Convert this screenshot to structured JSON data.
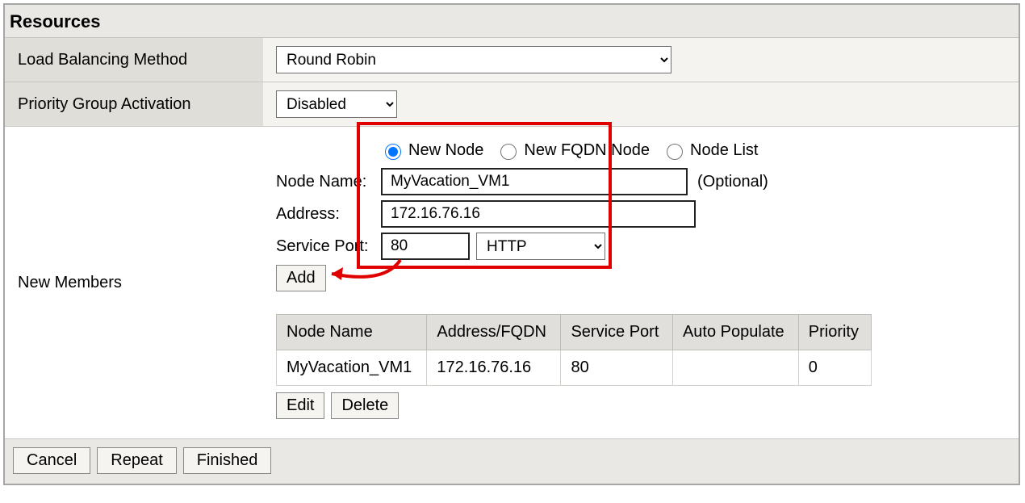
{
  "panel": {
    "title": "Resources"
  },
  "fields": {
    "lb_method_label": "Load Balancing Method",
    "lb_method_value": "Round Robin",
    "priority_label": "Priority Group Activation",
    "priority_value": "Disabled",
    "new_members_label": "New Members"
  },
  "node_type": {
    "new_node": "New Node",
    "new_fqdn": "New FQDN Node",
    "node_list": "Node List",
    "selected": "new_node"
  },
  "node_form": {
    "name_label": "Node Name:",
    "name_value": "MyVacation_VM1",
    "name_optional": "(Optional)",
    "address_label": "Address:",
    "address_value": "172.16.76.16",
    "port_label": "Service Port:",
    "port_value": "80",
    "port_proto": "HTTP"
  },
  "buttons": {
    "add": "Add",
    "edit": "Edit",
    "delete": "Delete",
    "cancel": "Cancel",
    "repeat": "Repeat",
    "finished": "Finished"
  },
  "members_table": {
    "headers": {
      "node_name": "Node Name",
      "address": "Address/FQDN",
      "port": "Service Port",
      "auto": "Auto Populate",
      "priority": "Priority"
    },
    "rows": [
      {
        "node_name": "MyVacation_VM1",
        "address": "172.16.76.16",
        "port": "80",
        "auto": "",
        "priority": "0"
      }
    ]
  }
}
